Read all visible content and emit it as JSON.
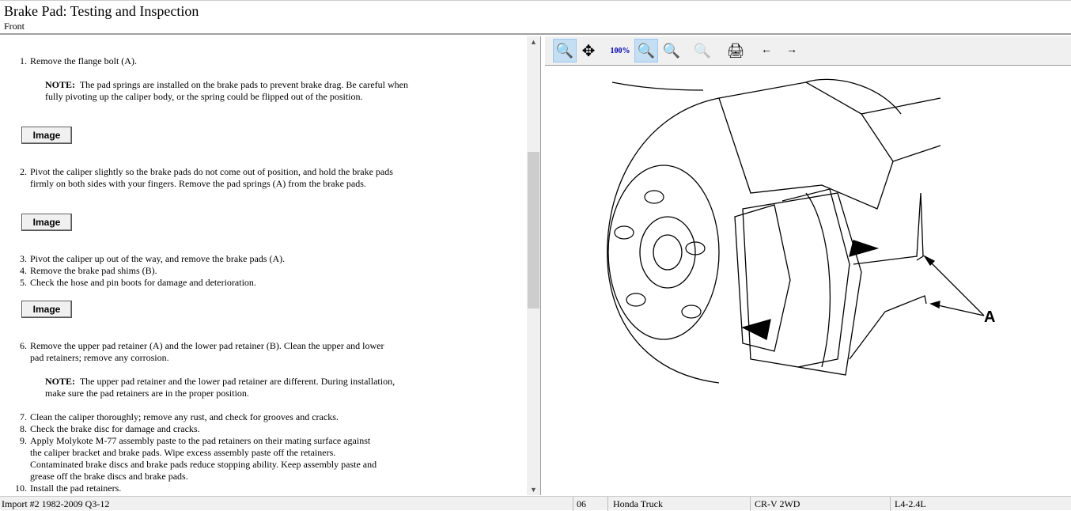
{
  "header": {
    "title": "Brake Pad:  Testing and Inspection",
    "subtitle": "Front"
  },
  "steps": [
    {
      "n": "1.",
      "text": "Remove the flange bolt (A)."
    },
    {
      "n": "2.",
      "text": "Pivot the caliper slightly so the brake pads do not come out of position, and hold the brake pads firmly on both sides with your fingers. Remove the pad springs (A) from the brake pads."
    },
    {
      "n": "3.",
      "text": "Pivot the caliper up out of the way, and remove the brake pads (A)."
    },
    {
      "n": "4.",
      "text": "Remove the brake pad shims (B)."
    },
    {
      "n": "5.",
      "text": "Check the hose and pin boots for damage and deterioration."
    },
    {
      "n": "6.",
      "text": "Remove the upper pad retainer (A) and the lower pad retainer (B). Clean the upper and lower pad retainers; remove any corrosion."
    },
    {
      "n": "7.",
      "text": "Clean the caliper thoroughly; remove any rust, and check for grooves and cracks."
    },
    {
      "n": "8.",
      "text": "Check the brake disc for damage and cracks."
    },
    {
      "n": "9.",
      "text": "Apply Molykote M-77 assembly paste to the pad retainers on their mating surface against the caliper bracket and brake pads. Wipe excess assembly paste off the retainers. Contaminated brake discs and brake pads reduce stopping ability. Keep assembly paste and grease off the brake discs and brake pads."
    },
    {
      "n": "10.",
      "text": "Install the pad retainers."
    }
  ],
  "notes": [
    {
      "label": "NOTE:",
      "text": "The pad springs are installed on the brake pads to prevent brake drag. Be careful when fully pivoting up the caliper body, or the spring could be flipped out of the position."
    },
    {
      "label": "NOTE:",
      "text": "The upper pad retainer and the lower pad retainer are different. During installation, make sure the pad retainers are in the proper position."
    }
  ],
  "image_button": "Image",
  "toolbar": [
    "zoom-in",
    "pan",
    "zoom-100",
    "zoom-fit",
    "zoom-width",
    "zoom-out",
    "print",
    "prev-image",
    "next-image"
  ],
  "figure": {
    "callout": "A"
  },
  "status": {
    "source": "Import #2 1982-2009 Q3-12",
    "year": "06",
    "make": "Honda Truck",
    "model": "CR-V 2WD",
    "engine": "L4-2.4L"
  }
}
